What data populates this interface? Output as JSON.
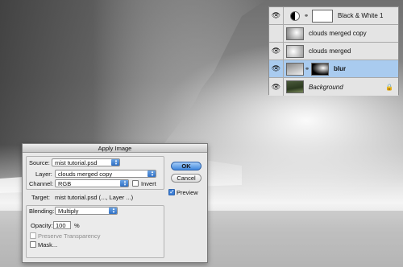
{
  "layers_panel": {
    "layers": [
      {
        "name": "Black & White 1",
        "visible": true,
        "selected": false,
        "italic": false,
        "adjustment": true
      },
      {
        "name": "clouds merged copy",
        "visible": false,
        "selected": false,
        "italic": false
      },
      {
        "name": "clouds merged",
        "visible": true,
        "selected": false,
        "italic": false
      },
      {
        "name": "blur",
        "visible": true,
        "selected": true,
        "italic": false
      },
      {
        "name": "Background",
        "visible": true,
        "selected": false,
        "italic": true,
        "locked": true
      }
    ]
  },
  "dialog": {
    "title": "Apply Image",
    "source_label": "Source:",
    "source_value": "mist tutorial.psd",
    "layer_label": "Layer:",
    "layer_value": "clouds merged copy",
    "channel_label": "Channel:",
    "channel_value": "RGB",
    "invert_label": "Invert",
    "target_label": "Target:",
    "target_value": "mist tutorial.psd (..., Layer ...)",
    "blending_label": "Blending:",
    "blending_value": "Multiply",
    "opacity_label": "Opacity:",
    "opacity_value": "100",
    "opacity_unit": "%",
    "preserve_label": "Preserve Transparency",
    "mask_label": "Mask...",
    "ok_label": "OK",
    "cancel_label": "Cancel",
    "preview_label": "Preview"
  }
}
